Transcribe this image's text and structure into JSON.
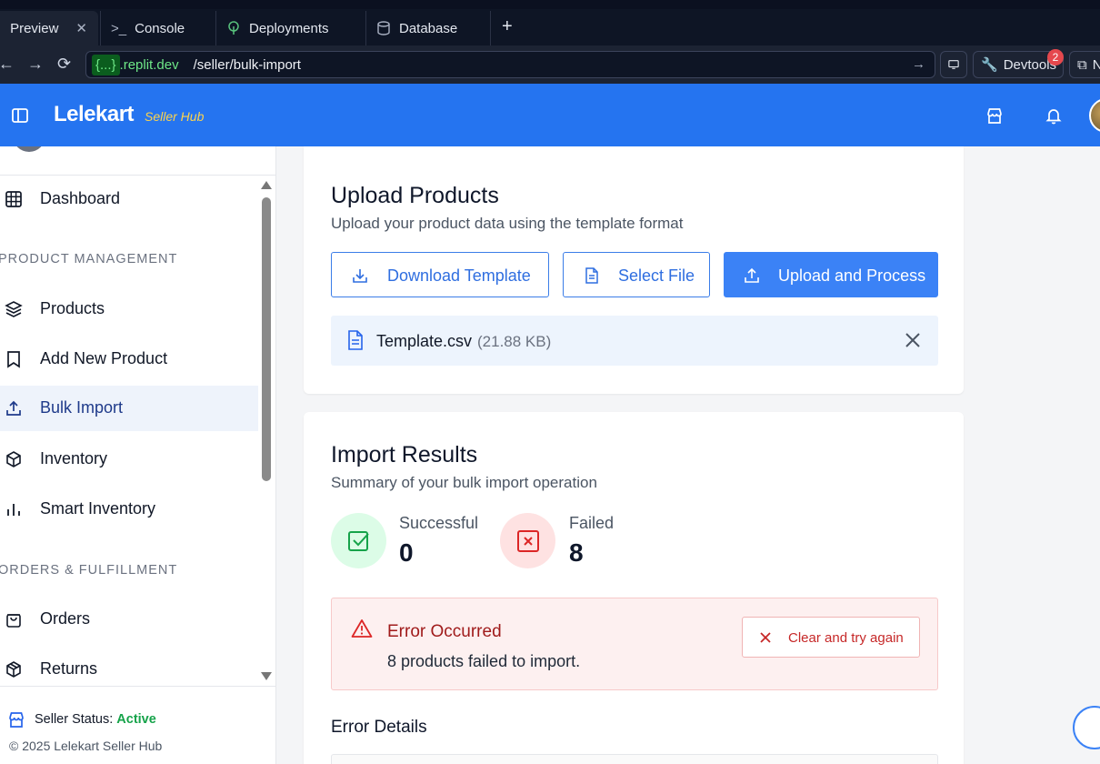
{
  "browser": {
    "tabs": [
      {
        "label": "Preview",
        "icon": "monitor-icon",
        "active": true
      },
      {
        "label": "Console",
        "icon": "terminal-icon"
      },
      {
        "label": "Deployments",
        "icon": "deploy-icon"
      },
      {
        "label": "Database",
        "icon": "database-icon"
      }
    ],
    "url_domain_badge": "{...}",
    "url_domain": ".replit.dev",
    "url_path": "/seller/bulk-import",
    "devtools_label": "Devtools",
    "devtools_badge": "2",
    "new_window_label": "N"
  },
  "header": {
    "brand": "Lelekart",
    "brand_sub": "Seller Hub",
    "colors": {
      "bar": "#2574f0",
      "sub": "#fcd34d"
    }
  },
  "sidebar": {
    "items": [
      {
        "label": "Dashboard",
        "icon": "grid-icon"
      },
      {
        "label": "Products",
        "icon": "layers-icon"
      },
      {
        "label": "Add New Product",
        "icon": "bookmark-icon"
      },
      {
        "label": "Bulk Import",
        "icon": "upload-icon",
        "active": true
      },
      {
        "label": "Inventory",
        "icon": "box-icon"
      },
      {
        "label": "Smart Inventory",
        "icon": "bar-chart-icon"
      },
      {
        "label": "Orders",
        "icon": "shopping-bag-icon"
      },
      {
        "label": "Returns",
        "icon": "package-icon"
      }
    ],
    "sections": [
      "PRODUCT MANAGEMENT",
      "ORDERS & FULFILLMENT"
    ],
    "status_label": "Seller Status:",
    "status_value": "Active",
    "copyright": "© 2025 Lelekart Seller Hub"
  },
  "upload": {
    "title": "Upload Products",
    "subtitle": "Upload your product data using the template format",
    "download_label": "Download Template",
    "select_label": "Select File",
    "process_label": "Upload and Process",
    "file_name": "Template.csv",
    "file_size": "(21.88 KB)"
  },
  "results": {
    "title": "Import Results",
    "subtitle": "Summary of your bulk import operation",
    "successful_label": "Successful",
    "successful_value": "0",
    "failed_label": "Failed",
    "failed_value": "8",
    "error_title": "Error Occurred",
    "error_message": "8 products failed to import.",
    "clear_label": "Clear and try again",
    "details_title": "Error Details"
  }
}
